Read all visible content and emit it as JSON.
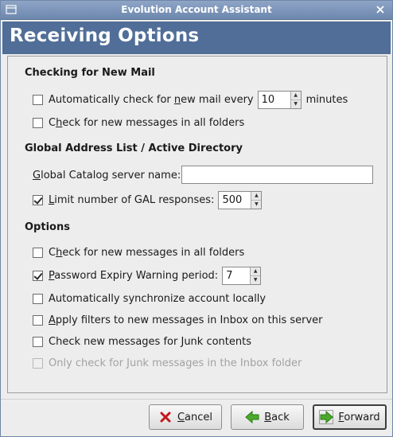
{
  "window": {
    "title": "Evolution Account Assistant"
  },
  "page": {
    "heading": "Receiving Options"
  },
  "sections": {
    "checking": {
      "title": "Checking for New Mail",
      "auto_check": {
        "label_pre": "Automatically check for ",
        "label_key": "n",
        "label_post": "ew mail every",
        "checked": false,
        "value": "10",
        "unit": "minutes"
      },
      "check_all_folders": {
        "label_pre": "C",
        "label_key": "h",
        "label_post": "eck for new messages in all folders",
        "checked": false
      }
    },
    "gal": {
      "title": "Global Address List / Active Directory",
      "catalog": {
        "label_key": "G",
        "label_post": "lobal Catalog server name:",
        "value": ""
      },
      "limit": {
        "label_key": "L",
        "label_post": "imit number of GAL responses:",
        "checked": true,
        "value": "500"
      }
    },
    "options": {
      "title": "Options",
      "check_all_folders": {
        "label_pre": "C",
        "label_key": "h",
        "label_post": "eck for new messages in all folders",
        "checked": false
      },
      "password_expiry": {
        "label_key": "P",
        "label_post": "assword Expiry Warning period:",
        "checked": true,
        "value": "7"
      },
      "auto_sync": {
        "label": "Automatically synchronize account locally",
        "checked": false
      },
      "apply_filters": {
        "label_key": "A",
        "label_post": "pply filters to new messages in Inbox on this server",
        "checked": false
      },
      "junk_check": {
        "label_pre": "Check new messages for ",
        "label_key": "J",
        "label_post": "unk contents",
        "checked": false
      },
      "junk_inbox_only": {
        "label_pre": "Only check for ",
        "label_key": "J",
        "label_post": "unk messages in the Inbox folder",
        "checked": false,
        "disabled": true
      }
    }
  },
  "buttons": {
    "cancel": {
      "label_key": "C",
      "label_post": "ancel"
    },
    "back": {
      "label_key": "B",
      "label_post": "ack"
    },
    "forward": {
      "label_key": "F",
      "label_post": "orward"
    }
  },
  "colors": {
    "titlebar": "#7b93b7",
    "header": "#506e97",
    "accent_green": "#4caa2a",
    "cancel_red": "#c4161c"
  }
}
